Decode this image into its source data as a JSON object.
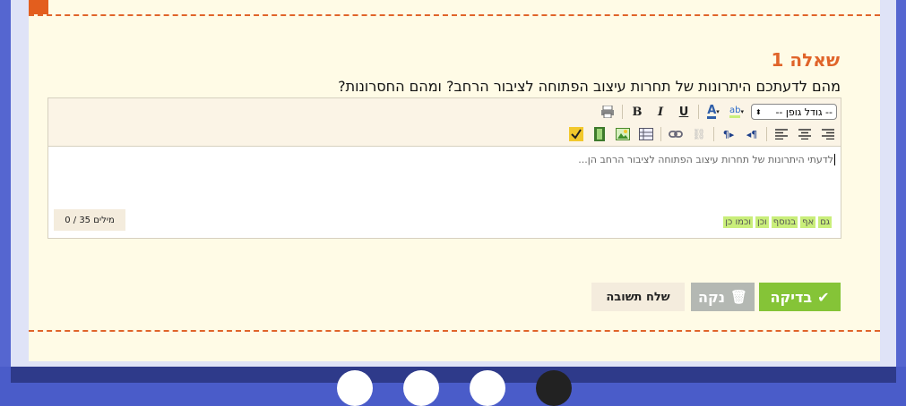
{
  "question": {
    "title": "שאלה 1",
    "text": "מהם לדעתכם היתרונות של תחרות עיצוב הפתוחה לציבור הרחב? ומהם החסרונות?"
  },
  "toolbar": {
    "font_size_select": "-- גודל גופן --",
    "bold": "B",
    "italic": "I",
    "underline": "U",
    "font_color": "A"
  },
  "editor": {
    "content": "לדעתי היתרונות של תחרות עיצוב הפתוחה לציבור הרחב הן...",
    "word_count": "מילים 35 / 0",
    "keywords": [
      "גם",
      "אף",
      "בנוסף",
      "וכן",
      "וכמו כן"
    ]
  },
  "buttons": {
    "check": "בדיקה",
    "clear": "נקה",
    "send": "שלח תשובה"
  },
  "colors": {
    "accent_orange": "#e0642a",
    "check_green": "#85c437",
    "card_bg": "#fffbe6"
  }
}
